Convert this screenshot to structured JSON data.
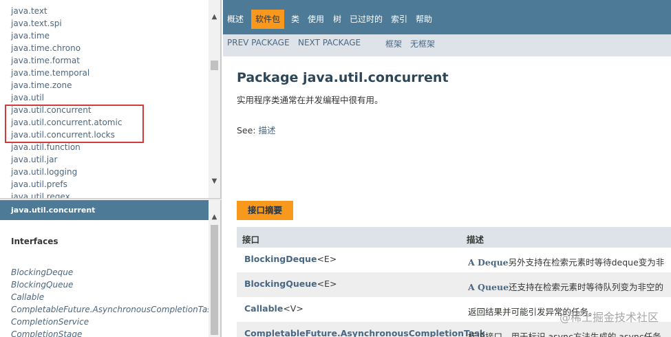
{
  "packages": [
    "java.text",
    "java.text.spi",
    "java.time",
    "java.time.chrono",
    "java.time.format",
    "java.time.temporal",
    "java.time.zone",
    "java.util",
    "java.util.concurrent",
    "java.util.concurrent.atomic",
    "java.util.concurrent.locks",
    "java.util.function",
    "java.util.jar",
    "java.util.logging",
    "java.util.prefs",
    "java.util.regex"
  ],
  "class_frame": {
    "header": "java.util.concurrent",
    "section_title": "Interfaces",
    "interfaces": [
      "BlockingDeque",
      "BlockingQueue",
      "Callable",
      "CompletableFuture.AsynchronousCompletionTask",
      "CompletionService",
      "CompletionStage"
    ]
  },
  "top_nav": {
    "items": [
      "概述",
      "软件包",
      "类",
      "使用",
      "树",
      "已过时的",
      "索引",
      "帮助"
    ],
    "active": "软件包"
  },
  "sub_nav": {
    "prev": "PREV PACKAGE",
    "next": "NEXT PACKAGE",
    "frames": "框架",
    "no_frames": "无框架"
  },
  "main": {
    "title": "Package java.util.concurrent",
    "description": "实用程序类通常在并发编程中很有用。",
    "see_label": "See: ",
    "see_link": "描述",
    "summary_tab": "接口摘要",
    "table_headers": [
      "接口",
      "描述"
    ],
    "rows": [
      {
        "name": "BlockingDeque",
        "type_param": "<E>",
        "desc_code": "A Deque",
        "desc": "另外支持在检索元素时等待deque变为非"
      },
      {
        "name": "BlockingQueue",
        "type_param": "<E>",
        "desc_code": "A Queue",
        "desc": "还支持在检索元素时等待队列变为非空的"
      },
      {
        "name": "Callable",
        "type_param": "<V>",
        "desc_code": "",
        "desc": "返回结果并可能引发异常的任务。"
      },
      {
        "name": "CompletableFuture.AsynchronousCompletionTask",
        "type_param": "",
        "desc_code": "",
        "desc": "标识接口，用于标识 async方法生成的 async任务"
      }
    ]
  },
  "watermark": "@稀土掘金技术社区",
  "colors": {
    "nav_bg": "#4d7a97",
    "active_tab": "#f8981d",
    "link": "#4a6782",
    "highlight_border": "#d23b3b"
  }
}
